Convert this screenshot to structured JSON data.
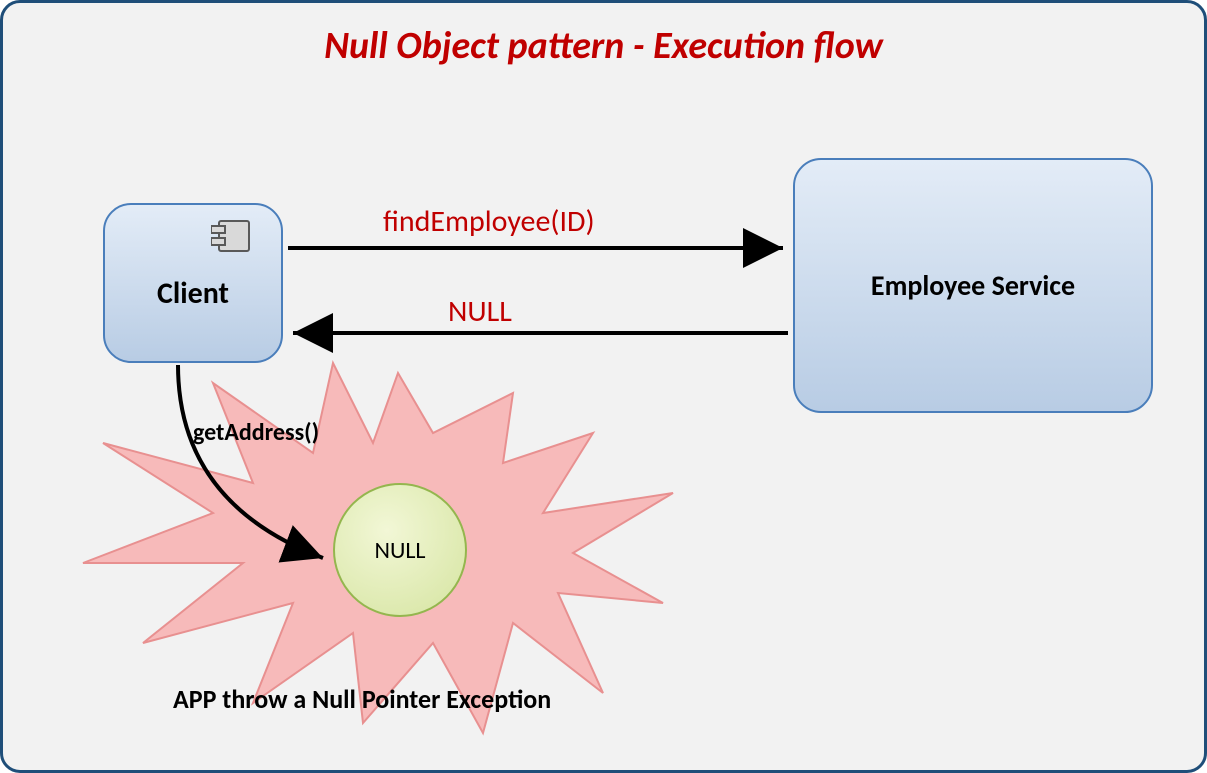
{
  "title": "Null Object pattern - Execution flow",
  "nodes": {
    "client": "Client",
    "service": "Employee Service",
    "null_circle": "NULL"
  },
  "edges": {
    "find_employee": "findEmployee(ID)",
    "null_return": "NULL",
    "get_address": "getAddress()"
  },
  "exception_text": "APP throw a Null Pointer Exception"
}
